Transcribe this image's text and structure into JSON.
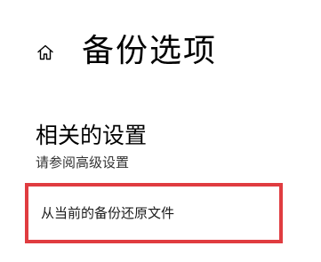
{
  "header": {
    "icon": "home-icon",
    "title": "备份选项"
  },
  "related_settings": {
    "title": "相关的设置",
    "see_advanced_label": "请参阅高级设置",
    "restore_label": "从当前的备份还原文件",
    "highlight_color": "#e03c40"
  }
}
